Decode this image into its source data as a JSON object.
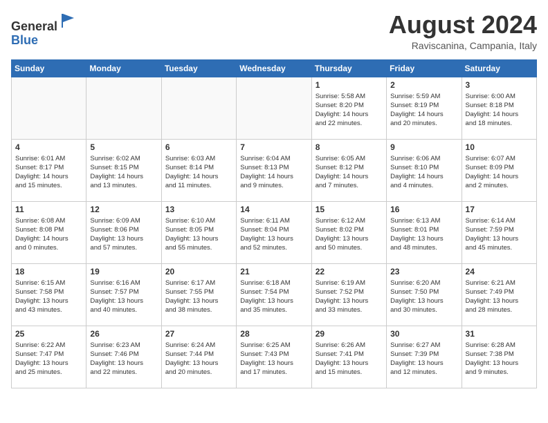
{
  "header": {
    "logo_general": "General",
    "logo_blue": "Blue",
    "month_year": "August 2024",
    "location": "Raviscanina, Campania, Italy"
  },
  "weekdays": [
    "Sunday",
    "Monday",
    "Tuesday",
    "Wednesday",
    "Thursday",
    "Friday",
    "Saturday"
  ],
  "weeks": [
    [
      {
        "day": "",
        "info": ""
      },
      {
        "day": "",
        "info": ""
      },
      {
        "day": "",
        "info": ""
      },
      {
        "day": "",
        "info": ""
      },
      {
        "day": "1",
        "info": "Sunrise: 5:58 AM\nSunset: 8:20 PM\nDaylight: 14 hours\nand 22 minutes."
      },
      {
        "day": "2",
        "info": "Sunrise: 5:59 AM\nSunset: 8:19 PM\nDaylight: 14 hours\nand 20 minutes."
      },
      {
        "day": "3",
        "info": "Sunrise: 6:00 AM\nSunset: 8:18 PM\nDaylight: 14 hours\nand 18 minutes."
      }
    ],
    [
      {
        "day": "4",
        "info": "Sunrise: 6:01 AM\nSunset: 8:17 PM\nDaylight: 14 hours\nand 15 minutes."
      },
      {
        "day": "5",
        "info": "Sunrise: 6:02 AM\nSunset: 8:15 PM\nDaylight: 14 hours\nand 13 minutes."
      },
      {
        "day": "6",
        "info": "Sunrise: 6:03 AM\nSunset: 8:14 PM\nDaylight: 14 hours\nand 11 minutes."
      },
      {
        "day": "7",
        "info": "Sunrise: 6:04 AM\nSunset: 8:13 PM\nDaylight: 14 hours\nand 9 minutes."
      },
      {
        "day": "8",
        "info": "Sunrise: 6:05 AM\nSunset: 8:12 PM\nDaylight: 14 hours\nand 7 minutes."
      },
      {
        "day": "9",
        "info": "Sunrise: 6:06 AM\nSunset: 8:10 PM\nDaylight: 14 hours\nand 4 minutes."
      },
      {
        "day": "10",
        "info": "Sunrise: 6:07 AM\nSunset: 8:09 PM\nDaylight: 14 hours\nand 2 minutes."
      }
    ],
    [
      {
        "day": "11",
        "info": "Sunrise: 6:08 AM\nSunset: 8:08 PM\nDaylight: 14 hours\nand 0 minutes."
      },
      {
        "day": "12",
        "info": "Sunrise: 6:09 AM\nSunset: 8:06 PM\nDaylight: 13 hours\nand 57 minutes."
      },
      {
        "day": "13",
        "info": "Sunrise: 6:10 AM\nSunset: 8:05 PM\nDaylight: 13 hours\nand 55 minutes."
      },
      {
        "day": "14",
        "info": "Sunrise: 6:11 AM\nSunset: 8:04 PM\nDaylight: 13 hours\nand 52 minutes."
      },
      {
        "day": "15",
        "info": "Sunrise: 6:12 AM\nSunset: 8:02 PM\nDaylight: 13 hours\nand 50 minutes."
      },
      {
        "day": "16",
        "info": "Sunrise: 6:13 AM\nSunset: 8:01 PM\nDaylight: 13 hours\nand 48 minutes."
      },
      {
        "day": "17",
        "info": "Sunrise: 6:14 AM\nSunset: 7:59 PM\nDaylight: 13 hours\nand 45 minutes."
      }
    ],
    [
      {
        "day": "18",
        "info": "Sunrise: 6:15 AM\nSunset: 7:58 PM\nDaylight: 13 hours\nand 43 minutes."
      },
      {
        "day": "19",
        "info": "Sunrise: 6:16 AM\nSunset: 7:57 PM\nDaylight: 13 hours\nand 40 minutes."
      },
      {
        "day": "20",
        "info": "Sunrise: 6:17 AM\nSunset: 7:55 PM\nDaylight: 13 hours\nand 38 minutes."
      },
      {
        "day": "21",
        "info": "Sunrise: 6:18 AM\nSunset: 7:54 PM\nDaylight: 13 hours\nand 35 minutes."
      },
      {
        "day": "22",
        "info": "Sunrise: 6:19 AM\nSunset: 7:52 PM\nDaylight: 13 hours\nand 33 minutes."
      },
      {
        "day": "23",
        "info": "Sunrise: 6:20 AM\nSunset: 7:50 PM\nDaylight: 13 hours\nand 30 minutes."
      },
      {
        "day": "24",
        "info": "Sunrise: 6:21 AM\nSunset: 7:49 PM\nDaylight: 13 hours\nand 28 minutes."
      }
    ],
    [
      {
        "day": "25",
        "info": "Sunrise: 6:22 AM\nSunset: 7:47 PM\nDaylight: 13 hours\nand 25 minutes."
      },
      {
        "day": "26",
        "info": "Sunrise: 6:23 AM\nSunset: 7:46 PM\nDaylight: 13 hours\nand 22 minutes."
      },
      {
        "day": "27",
        "info": "Sunrise: 6:24 AM\nSunset: 7:44 PM\nDaylight: 13 hours\nand 20 minutes."
      },
      {
        "day": "28",
        "info": "Sunrise: 6:25 AM\nSunset: 7:43 PM\nDaylight: 13 hours\nand 17 minutes."
      },
      {
        "day": "29",
        "info": "Sunrise: 6:26 AM\nSunset: 7:41 PM\nDaylight: 13 hours\nand 15 minutes."
      },
      {
        "day": "30",
        "info": "Sunrise: 6:27 AM\nSunset: 7:39 PM\nDaylight: 13 hours\nand 12 minutes."
      },
      {
        "day": "31",
        "info": "Sunrise: 6:28 AM\nSunset: 7:38 PM\nDaylight: 13 hours\nand 9 minutes."
      }
    ]
  ]
}
